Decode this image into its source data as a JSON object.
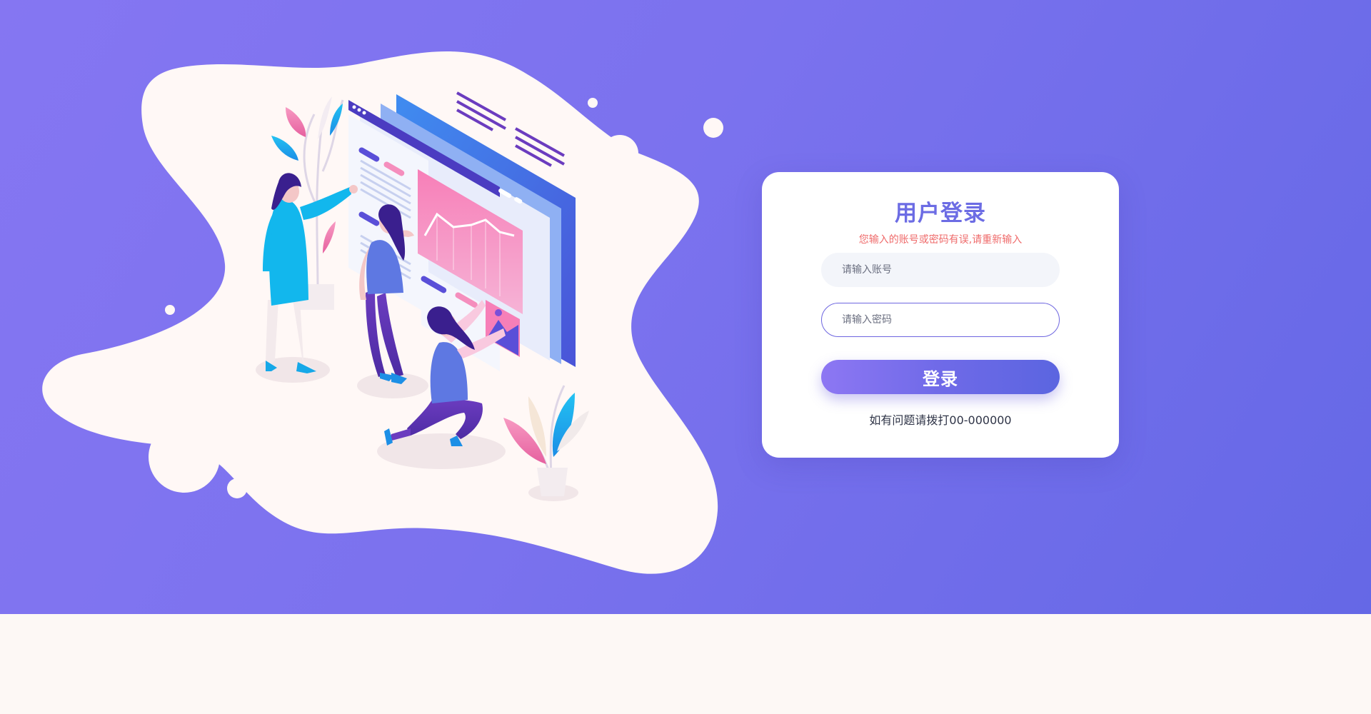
{
  "login": {
    "title": "用户登录",
    "error_message": "您输入的账号或密码有误,请重新输入",
    "account_placeholder": "请输入账号",
    "account_value": "",
    "password_placeholder": "请输入密码",
    "password_value": "",
    "submit_label": "登录",
    "help_text": "如有问题请拨打00-000000"
  },
  "theme": {
    "hero_gradient_start": "#8576f2",
    "hero_gradient_end": "#6568e6",
    "title_color": "#6c6ce4",
    "error_color": "#ef6b6b",
    "blob_color": "#fff8f6",
    "footer_color": "#fdf8f5"
  },
  "illustration": {
    "name": "team-dashboard-illustration",
    "elements": [
      "blob-shape",
      "browser-window-graphic",
      "line-chart-graphic",
      "woman-pointing-figure",
      "woman-standing-figure",
      "woman-kneeling-figure",
      "plant-graphic",
      "decorative-dots"
    ]
  }
}
